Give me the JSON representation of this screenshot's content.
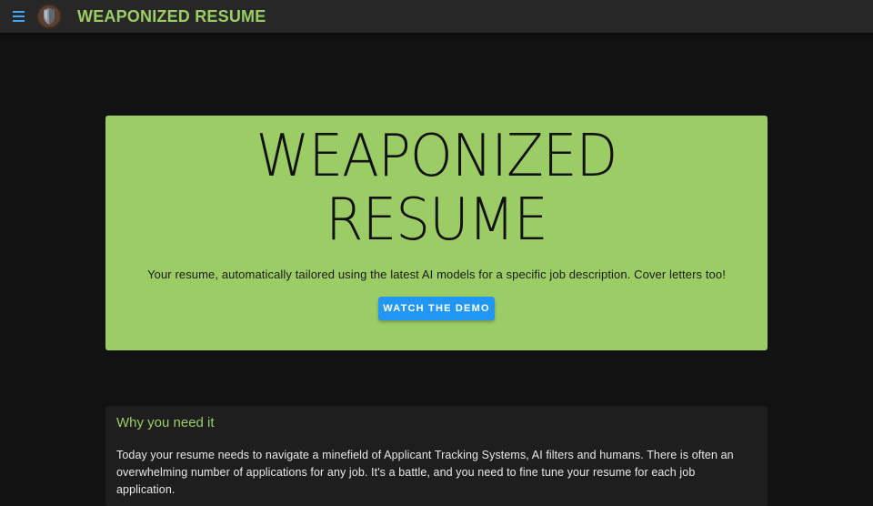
{
  "appbar": {
    "title": "WEAPONIZED RESUME",
    "menu_icon": "hamburger-menu-icon",
    "logo_icon": "shield-logo-icon"
  },
  "hero": {
    "title_line1": "WEAPONIZED",
    "title_line2": "RESUME",
    "subtitle": "Your resume, automatically tailored using the latest AI models for a specific job description. Cover letters too!",
    "button_label": "WATCH THE DEMO"
  },
  "why": {
    "title": "Why you need it",
    "text": "Today your resume needs to navigate a minefield of Applicant Tracking Systems, AI filters and humans. There is often an overwhelming number of applications for any job. It's a battle, and you need to fine tune your resume for each job application."
  },
  "colors": {
    "accent_green": "#9ccc65",
    "button_blue": "#2196f3",
    "background": "#121212",
    "appbar": "#272727",
    "card": "#1e1e1e"
  }
}
